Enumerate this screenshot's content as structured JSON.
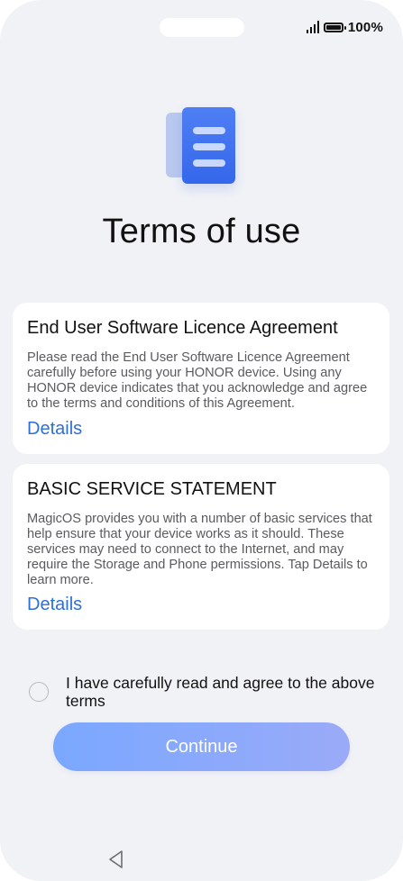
{
  "status_bar": {
    "battery_percent": "100%",
    "icons": [
      "signal-icon",
      "battery-icon"
    ]
  },
  "hero": {
    "icon": "document-icon",
    "title": "Terms of use"
  },
  "cards": [
    {
      "title": "End User Software Licence Agreement",
      "text": "Please read the End User Software Licence Agreement carefully before using your HONOR device. Using any HONOR device indicates that you acknowledge and agree to the terms and conditions of this Agreement.",
      "link_label": "Details"
    },
    {
      "title": "BASIC SERVICE STATEMENT",
      "text": "MagicOS provides you with a number of basic services that help ensure that your device works as it should. These services may need to connect to the Internet, and may require the Storage and Phone permissions. Tap Details to learn more.",
      "link_label": "Details"
    }
  ],
  "agreement": {
    "label": "I have carefully read and agree to the above terms",
    "checked": false
  },
  "continue_button": {
    "label": "Continue"
  },
  "colors": {
    "background": "#f1f2f6",
    "card": "#ffffff",
    "link": "#2f6fd6",
    "icon_blue": "#3467ea",
    "button_start": "#7aa8ff",
    "button_end": "#9aaaf8"
  },
  "nav_bar": {
    "icons": [
      "back-triangle-icon"
    ]
  }
}
